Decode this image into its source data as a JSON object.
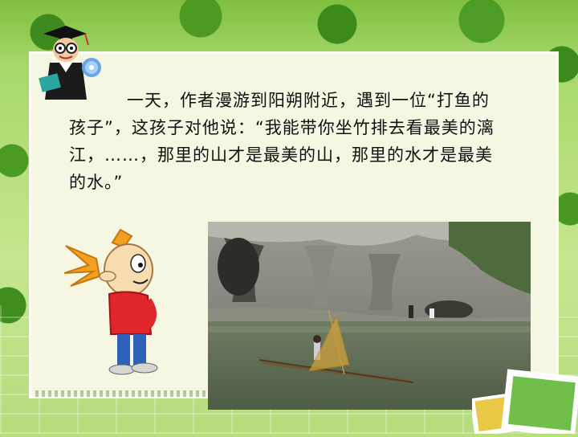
{
  "slide": {
    "paragraph": "一天，作者漫游到阳朔附近，遇到一位“打鱼的孩子”，这孩子对他说：“我能带你坐竹排去看最美的漓江，……，那里的山才是最美的山，那里的水才是最美的水。”"
  },
  "images": {
    "professor": "professor-clipart",
    "kid": "cartoon-kid-clipart",
    "photo": "li-river-bamboo-raft-photo",
    "corner": "stacked-photos-decoration"
  }
}
